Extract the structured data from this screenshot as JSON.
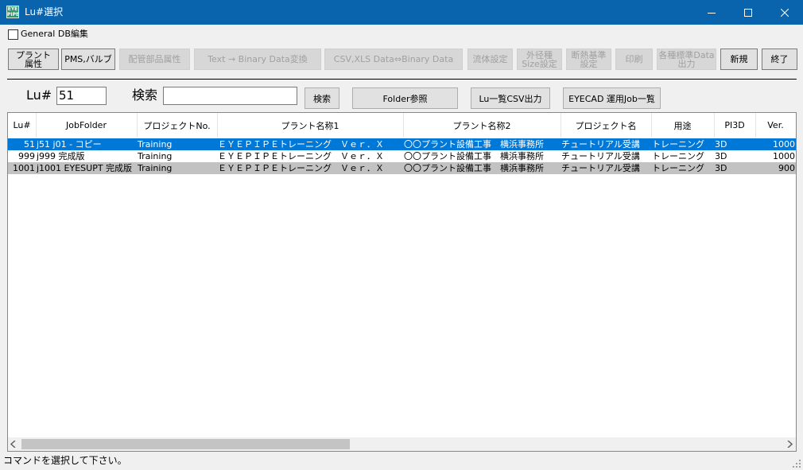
{
  "window": {
    "title": "Lu#選択",
    "app_icon_text": "EYE PIPE"
  },
  "general_db": {
    "label": "General DB編集",
    "checked": false
  },
  "toolbar": [
    {
      "label": "プラント\n属性",
      "enabled": true
    },
    {
      "label": "PMS,バルブ",
      "enabled": true
    },
    {
      "label": "配管部品属性",
      "enabled": false
    },
    {
      "label": "Text → Binary Data変換",
      "enabled": false
    },
    {
      "label": "CSV,XLS Data⇔Binary Data",
      "enabled": false
    },
    {
      "label": "流体設定",
      "enabled": false
    },
    {
      "label": "外径種\nSize設定",
      "enabled": false
    },
    {
      "label": "断熱基準\n設定",
      "enabled": false
    },
    {
      "label": "印刷",
      "enabled": false
    },
    {
      "label": "各種標準Data\n出力",
      "enabled": false
    },
    {
      "label": "新規",
      "enabled": true
    },
    {
      "label": "終了",
      "enabled": true
    }
  ],
  "lu": {
    "label": "Lu#",
    "value": "51"
  },
  "search": {
    "label": "検索",
    "value": "",
    "button": "検索"
  },
  "buttons": {
    "folder": "Folder参照",
    "csv": "Lu一覧CSV出力",
    "jobs": "EYECAD 運用Job一覧"
  },
  "table": {
    "columns": [
      "Lu#",
      "JobFolder",
      "プロジェクトNo.",
      "プラント名称1",
      "プラント名称2",
      "プロジェクト名",
      "用途",
      "PI3D",
      "Ver."
    ],
    "rows": [
      [
        "51",
        "j51 j01 - コピー",
        "Training",
        "ＥＹＥＰＩＰＥトレーニング　Ｖｅｒ．Ｘ",
        "〇〇プラント設備工事　横浜事務所",
        "チュートリアル受講",
        "トレーニング",
        "3D",
        "1000"
      ],
      [
        "999",
        "j999 完成版",
        "Training",
        "ＥＹＥＰＩＰＥトレーニング　Ｖｅｒ．Ｘ",
        "〇〇プラント設備工事　横浜事務所",
        "チュートリアル受講",
        "トレーニング",
        "3D",
        "1000"
      ],
      [
        "1001",
        "j1001 EYESUPT 完成版",
        "Training",
        "ＥＹＥＰＩＰＥトレーニング　Ｖｅｒ．Ｘ",
        "〇〇プラント設備工事　横浜事務所",
        "チュートリアル受講",
        "トレーニング",
        "3D",
        "900"
      ]
    ],
    "selected_row": 0
  },
  "status": {
    "text": "コマンドを選択して下さい。"
  }
}
